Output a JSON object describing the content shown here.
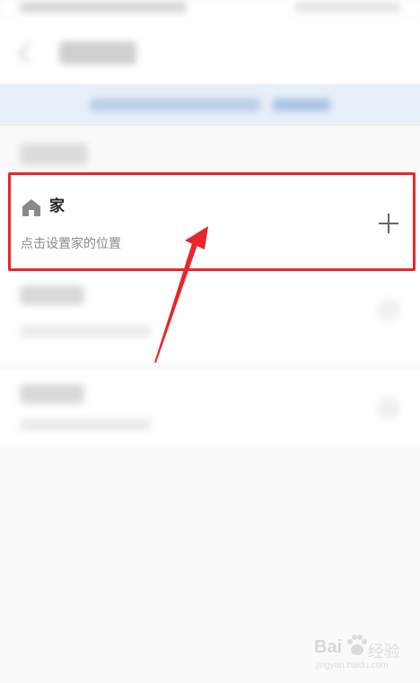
{
  "status_bar": {
    "left_text": "",
    "right_text": ""
  },
  "header": {
    "title": ""
  },
  "banner": {
    "text": "",
    "link": ""
  },
  "section": {
    "label": ""
  },
  "home": {
    "icon": "home-icon",
    "title": "家",
    "subtitle": "点击设置家的位置",
    "add_icon": "plus-icon"
  },
  "company": {
    "title": "",
    "subtitle": ""
  },
  "other": {
    "title": "",
    "subtitle": ""
  },
  "annotation": {
    "highlight_color": "#e8262a",
    "arrow_color": "#e8262a"
  },
  "watermark": {
    "logo": "Bai",
    "cn": "经验",
    "url": "jingyan.baidu.com"
  }
}
